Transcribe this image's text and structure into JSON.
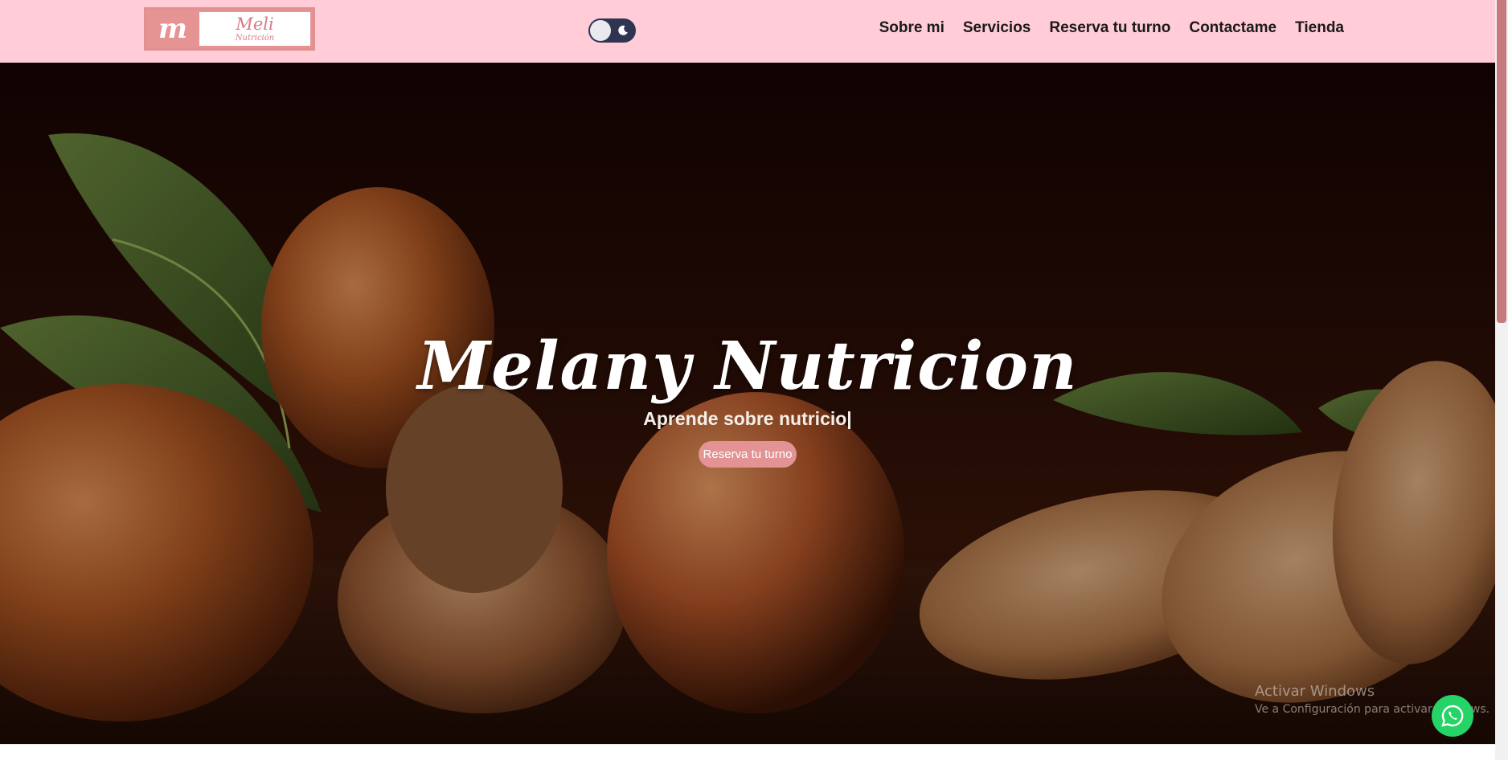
{
  "logo": {
    "mark": "m",
    "word": "Meli",
    "tagline": "Nutrición"
  },
  "theme_toggle": {
    "icon": "moon-icon"
  },
  "nav": {
    "items": [
      {
        "label": "Sobre mi"
      },
      {
        "label": "Servicios"
      },
      {
        "label": "Reserva tu turno"
      },
      {
        "label": "Contactame"
      },
      {
        "label": "Tienda"
      }
    ]
  },
  "hero": {
    "title": "Melany Nutricion",
    "subtitle": "Aprende sobre nutricio|",
    "button_label": "Reserva tu turno"
  },
  "watermark": {
    "line1": "Activar Windows",
    "line2": "Ve a Configuración para activar Windows."
  },
  "whatsapp": {
    "icon": "whatsapp-icon"
  },
  "colors": {
    "header_bg": "#ffccd8",
    "accent": "#e39393",
    "toggle_bg": "#2f3550",
    "whatsapp": "#25d366",
    "scroll_thumb": "#c77a7e"
  }
}
